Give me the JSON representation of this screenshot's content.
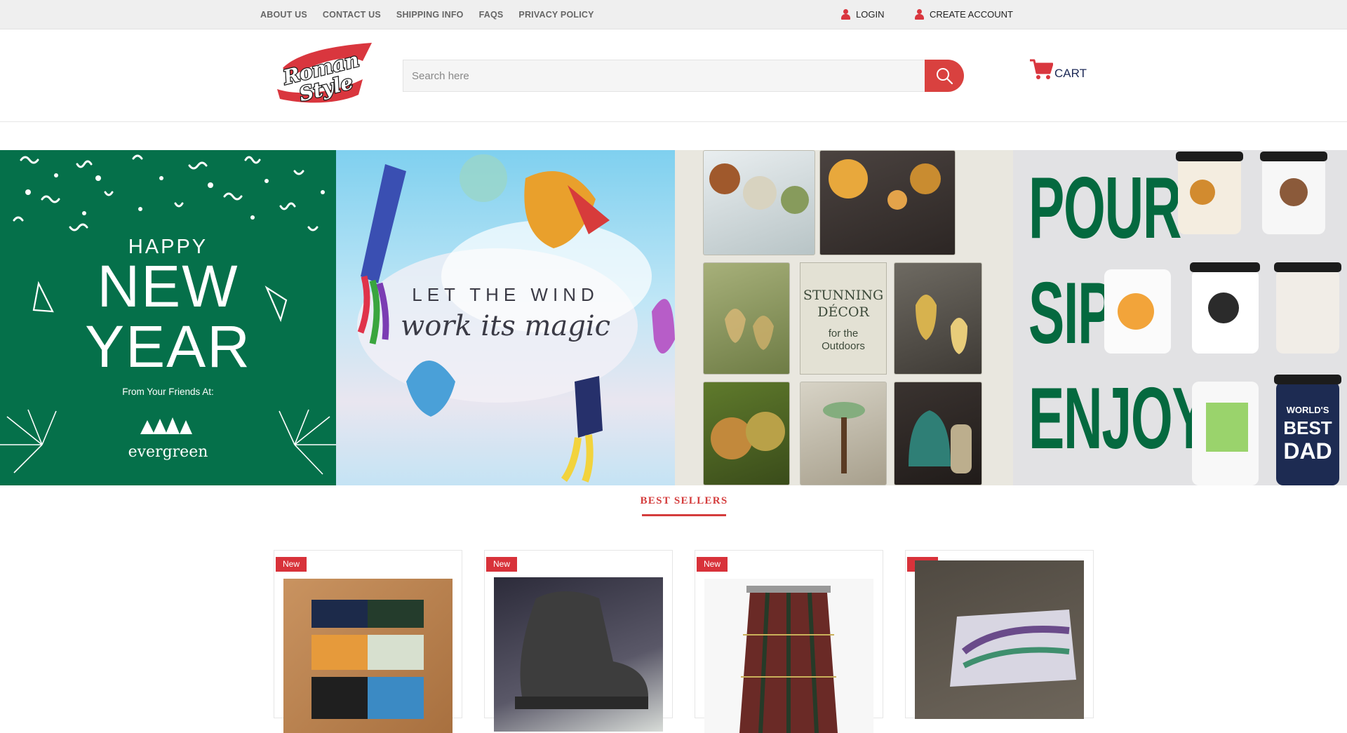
{
  "topbar": {
    "nav": [
      "ABOUT US",
      "CONTACT US",
      "SHIPPING INFO",
      "FAQS",
      "PRIVACY POLICY"
    ],
    "login_label": "LOGIN",
    "create_account_label": "CREATE ACCOUNT"
  },
  "header": {
    "logo_text": "Roman Style",
    "search_placeholder": "Search here",
    "cart_label": "CART"
  },
  "banner": {
    "new_year": {
      "line1": "HAPPY",
      "line2": "NEW",
      "line3": "YEAR",
      "from": "From Your Friends At:",
      "brand": "evergreen"
    },
    "wind": {
      "line1": "LET THE WIND",
      "line2": "work its magic"
    },
    "decor": {
      "title_line1": "STUNNING",
      "title_line2": "DÉCOR",
      "sub_line1": "for the",
      "sub_line2": "Outdoors"
    },
    "mugs": {
      "words": [
        "POUR",
        "SIP",
        "ENJOY"
      ],
      "mug_text_1": "WORLD'S",
      "mug_text_2": "BEST",
      "mug_text_3": "DAD"
    }
  },
  "best_sellers": {
    "title": "BEST SELLERS",
    "badge": "New",
    "products": [
      {
        "image": "patterned-boxer-shorts"
      },
      {
        "image": "black-leather-boot"
      },
      {
        "image": "plaid-skirt"
      },
      {
        "image": "abstract-art-canvas"
      }
    ]
  },
  "colors": {
    "accent": "#d9363e",
    "new_year_green": "#05704a",
    "cart_text": "#1d2a57"
  }
}
